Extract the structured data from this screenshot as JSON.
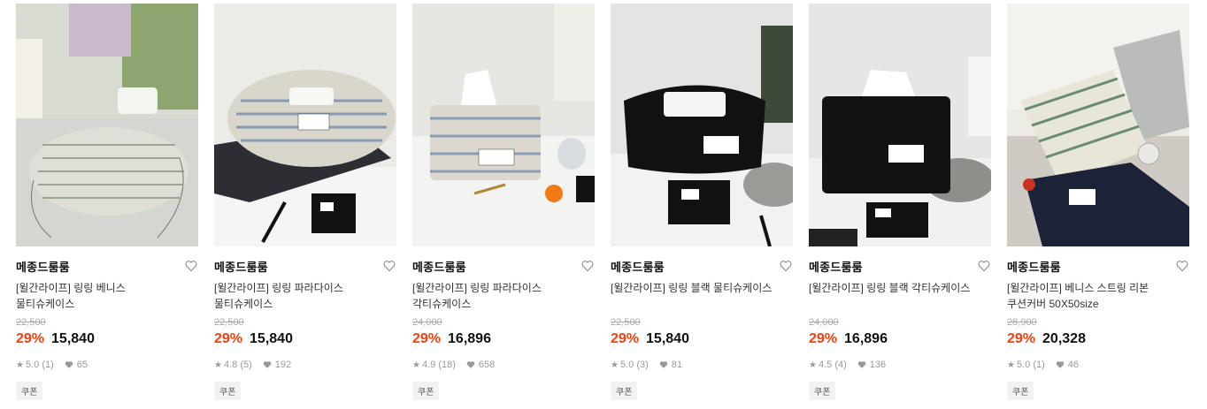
{
  "products": [
    {
      "brand": "메종드룸룸",
      "title_line1": "[윌간라이프] 링링 베니스",
      "title_line2": "물티슈케이스",
      "original_price": "22,500",
      "discount": "29%",
      "price": "15,840",
      "rating": "5.0 (1)",
      "likes": "65",
      "coupon": "쿠폰",
      "icon": "heart-outline-icon"
    },
    {
      "brand": "메종드룸룸",
      "title_line1": "[윌간라이프] 링링 파라다이스",
      "title_line2": "물티슈케이스",
      "original_price": "22,500",
      "discount": "29%",
      "price": "15,840",
      "rating": "4.8 (5)",
      "likes": "192",
      "coupon": "쿠폰",
      "icon": "heart-outline-icon"
    },
    {
      "brand": "메종드룸룸",
      "title_line1": "[윌간라이프] 링링 파라다이스",
      "title_line2": "각티슈케이스",
      "original_price": "24,000",
      "discount": "29%",
      "price": "16,896",
      "rating": "4.9 (18)",
      "likes": "658",
      "coupon": "쿠폰",
      "icon": "heart-outline-icon"
    },
    {
      "brand": "메종드룸룸",
      "title_line1": "[윌간라이프] 링링 블랙 물티슈케이스",
      "title_line2": "",
      "original_price": "22,500",
      "discount": "29%",
      "price": "15,840",
      "rating": "5.0 (3)",
      "likes": "81",
      "coupon": "쿠폰",
      "icon": "heart-outline-icon"
    },
    {
      "brand": "메종드룸룸",
      "title_line1": "[윌간라이프] 링링 블랙 각티슈케이스",
      "title_line2": "",
      "original_price": "24,000",
      "discount": "29%",
      "price": "16,896",
      "rating": "4.5 (4)",
      "likes": "136",
      "coupon": "쿠폰",
      "icon": "heart-outline-icon"
    },
    {
      "brand": "메종드룸룸",
      "title_line1": "[윌간라이프] 베니스 스트링 리본",
      "title_line2": "쿠션커버 50X50size",
      "original_price": "28,900",
      "discount": "29%",
      "price": "20,328",
      "rating": "5.0 (1)",
      "likes": "46",
      "coupon": "쿠폰",
      "icon": "heart-outline-icon"
    }
  ],
  "colors": {
    "discount": "#f2420f",
    "price": "#111111",
    "muted": "#999999",
    "coupon_bg": "#f2f2f2"
  }
}
